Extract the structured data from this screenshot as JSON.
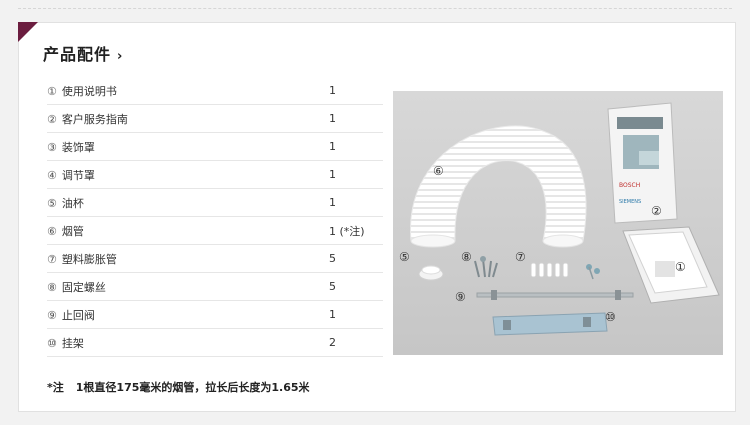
{
  "section": {
    "title": "产品配件",
    "title_arrow": "›"
  },
  "parts": [
    {
      "num": "①",
      "name": "使用说明书",
      "qty": "1"
    },
    {
      "num": "②",
      "name": "客户服务指南",
      "qty": "1"
    },
    {
      "num": "③",
      "name": "装饰罩",
      "qty": "1"
    },
    {
      "num": "④",
      "name": "调节罩",
      "qty": "1"
    },
    {
      "num": "⑤",
      "name": "油杯",
      "qty": "1"
    },
    {
      "num": "⑥",
      "name": "烟管",
      "qty": "1 (*注)"
    },
    {
      "num": "⑦",
      "name": "塑料膨胀管",
      "qty": "5"
    },
    {
      "num": "⑧",
      "name": "固定螺丝",
      "qty": "5"
    },
    {
      "num": "⑨",
      "name": "止回阀",
      "qty": "1"
    },
    {
      "num": "⑩",
      "name": "挂架",
      "qty": "2"
    }
  ],
  "photo": {
    "labels": [
      "⑥",
      "②",
      "①",
      "⑤",
      "⑧",
      "⑦",
      "⑨",
      "⑩"
    ],
    "booklet_brand": "BOSCH",
    "booklet_brand2": "SIEMENS"
  },
  "note": {
    "prefix": "*注",
    "text": "1根直径175毫米的烟管，拉长后长度为1.65米"
  },
  "colors": {
    "accent": "#6b1d3f",
    "divider": "#e6e6e6",
    "photo_bg": "#cfcfcf"
  }
}
